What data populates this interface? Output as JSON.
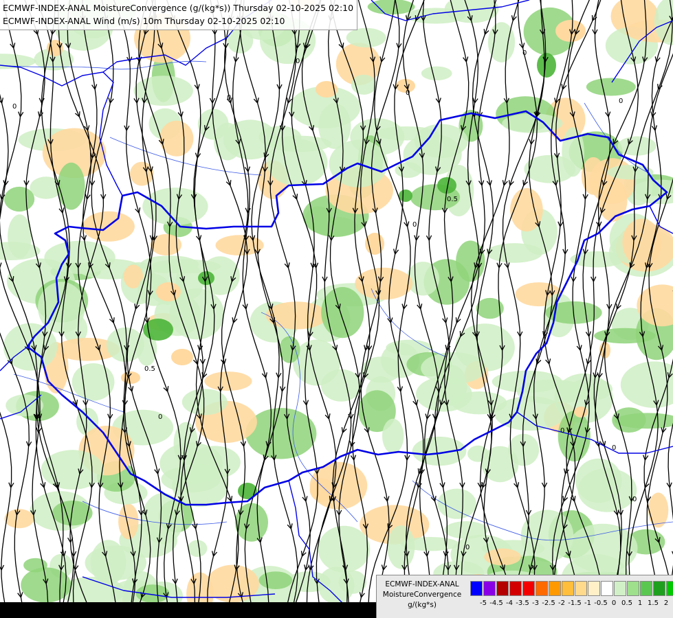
{
  "header": {
    "line1": "ECMWF-INDEX-ANAL MoistureConvergence (g/(kg*s)) Thursday 02-10-2025 02:10",
    "line2": "ECMWF-INDEX-ANAL Wind (m/s) 10m Thursday 02-10-2025 02:10"
  },
  "legend": {
    "line1": "ECMWF-INDEX-ANAL",
    "line2": "MoistureConvergence",
    "line3": "g/(kg*s)",
    "colors": [
      "#0000ff",
      "#8a00e6",
      "#b40000",
      "#d20000",
      "#f50000",
      "#ff6a00",
      "#ff9900",
      "#ffbe3c",
      "#ffd98c",
      "#fff0c8",
      "#ffffff",
      "#d2f0c8",
      "#9ee08c",
      "#5ac850",
      "#1ea01e",
      "#00c800"
    ],
    "ticks": [
      "-5",
      "-4.5",
      "-4",
      "-3.5",
      "-3",
      "-2.5",
      "-2",
      "-1.5",
      "-1",
      "-0.5",
      "0",
      "0.5",
      "1",
      "1.5",
      "2"
    ]
  },
  "map": {
    "contour_labels": [
      "0",
      "0",
      "0",
      "0",
      "0",
      "0",
      "0",
      "0",
      "0",
      "0",
      "0",
      "0.5",
      "0.5",
      "0"
    ],
    "palette": {
      "streamline": "#000000",
      "border": "#0000e6",
      "river": "#3c5ae6",
      "green_light": "#cfeec4",
      "green_mid": "#8fd47a",
      "green_dark": "#4cb53a",
      "orange_light": "#ffd9a0"
    }
  }
}
